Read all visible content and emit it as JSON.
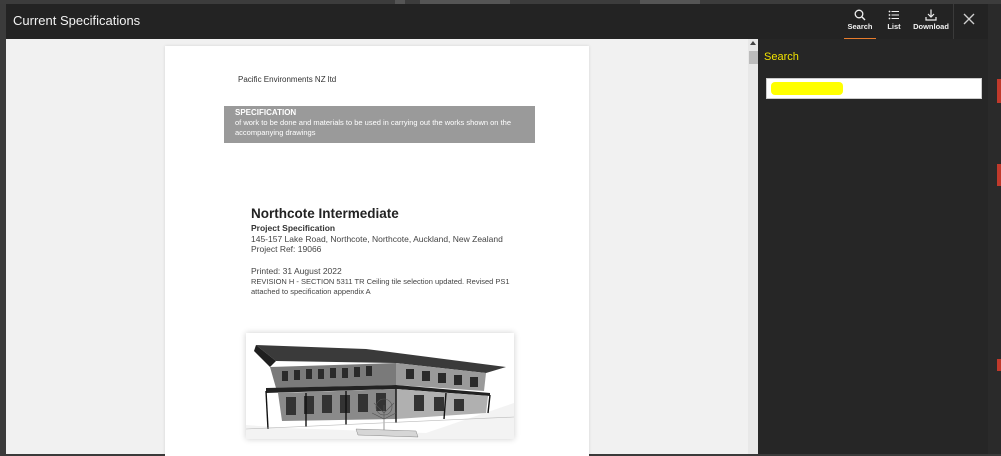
{
  "window": {
    "title": "Current Specifications"
  },
  "toolbar": {
    "search_label": "Search",
    "list_label": "List",
    "download_label": "Download"
  },
  "document": {
    "company": "Pacific Environments NZ ltd",
    "banner_heading": "SPECIFICATION",
    "banner_line1": "of work to be done and materials to be used in carrying out the works shown on the",
    "banner_line2": "accompanying drawings",
    "project_title": "Northcote Intermediate",
    "project_subtitle": "Project Specification",
    "address": "145-157 Lake Road, Northcote, Northcote, Auckland, New Zealand",
    "project_ref": "Project Ref: 19066",
    "printed": "Printed: 31 August 2022",
    "revision_line1": "REVISION H - SECTION 5311 TR Ceiling tile selection updated. Revised PS1",
    "revision_line2": "attached to specification appendix A"
  },
  "sidebar": {
    "search_heading": "Search",
    "search_value": "",
    "search_placeholder": ""
  },
  "colors": {
    "accent": "#e87c2c",
    "search_heading": "#f2e300",
    "highlight": "#ffff00"
  }
}
